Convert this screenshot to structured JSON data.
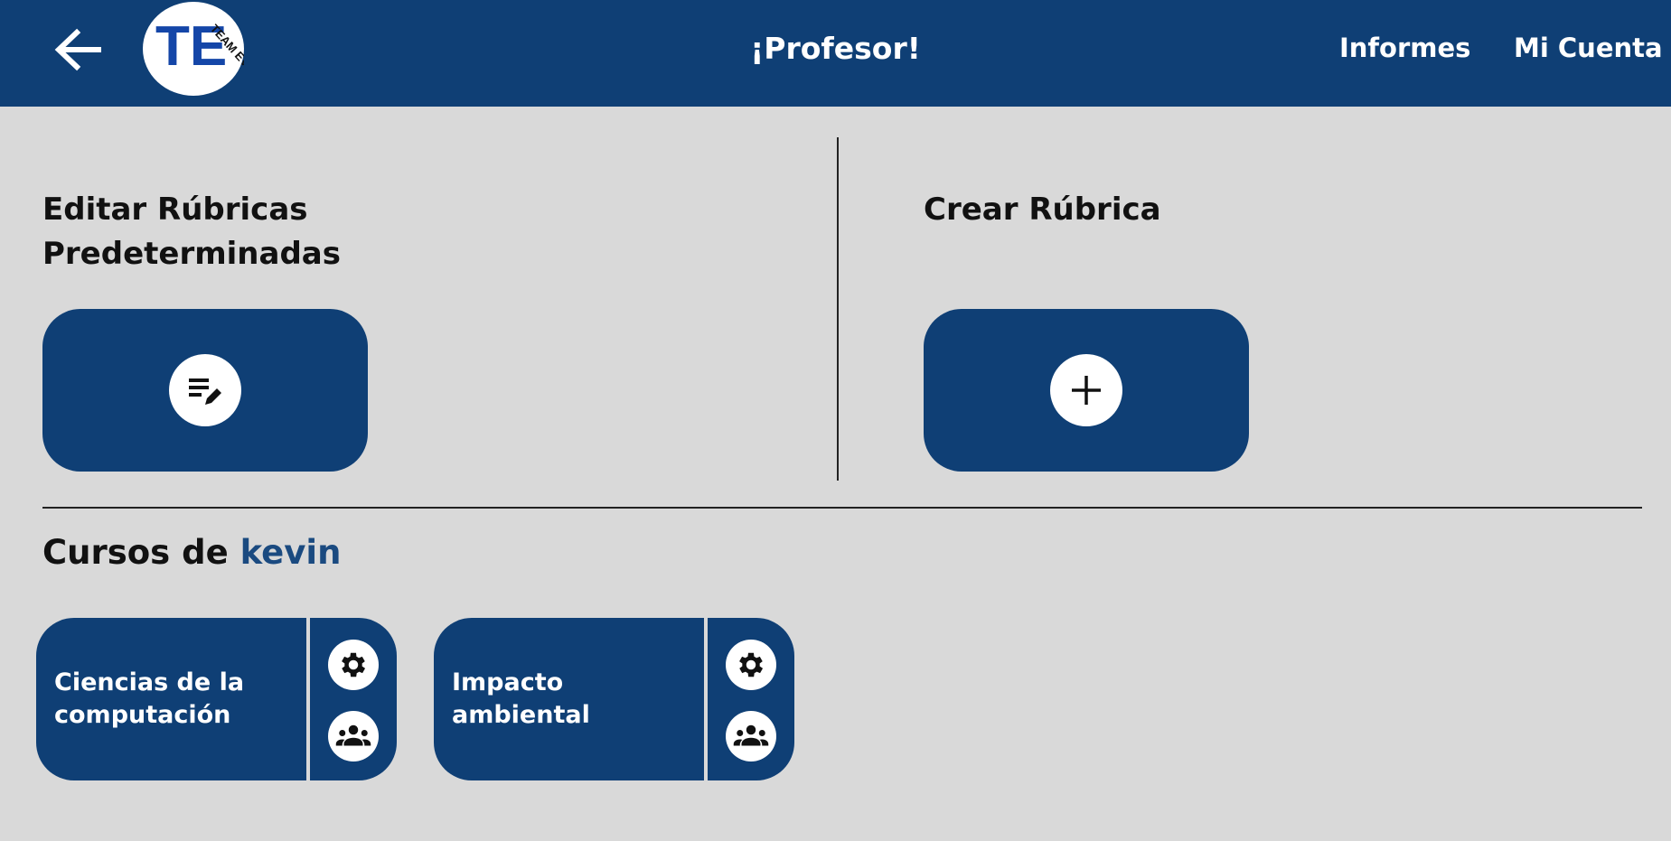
{
  "header": {
    "back_icon": "arrow-left-icon",
    "logo_text": "TE",
    "logo_subtext": "TEAM EVAL",
    "title": "¡Profesor!",
    "nav": {
      "reports": "Informes",
      "account": "Mi Cuenta"
    },
    "color": "#0f3f75"
  },
  "rubrics": {
    "edit_title": "Editar Rúbricas Predeterminadas",
    "edit_icon": "edit-list-icon",
    "create_title": "Crear Rúbrica",
    "create_icon": "plus-icon"
  },
  "courses": {
    "title_prefix": "Cursos de ",
    "username": "kevin",
    "items": [
      {
        "name": "Ciencias de la computación",
        "settings_icon": "gear-icon",
        "groups_icon": "groups-icon"
      },
      {
        "name": "Impacto ambiental",
        "settings_icon": "gear-icon",
        "groups_icon": "groups-icon"
      }
    ]
  },
  "colors": {
    "primary": "#0f3f75",
    "background": "#d9d9d9",
    "accent_text": "#1a4a80"
  }
}
